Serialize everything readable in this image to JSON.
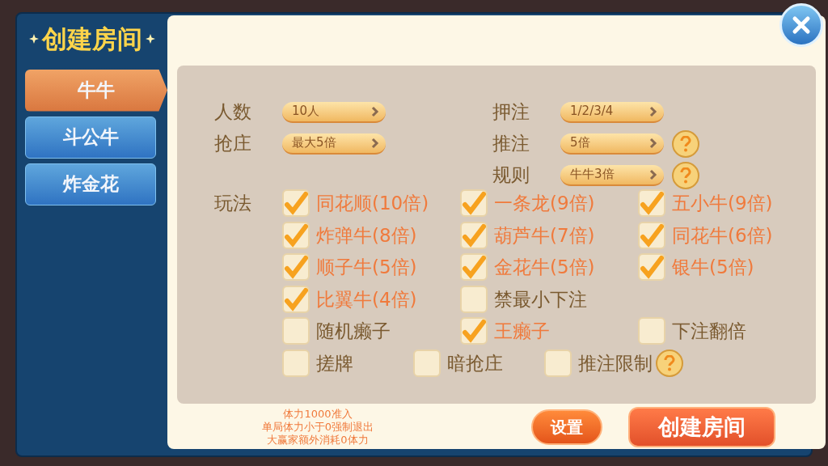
{
  "title": "创建房间",
  "tabs": [
    {
      "label": "牛牛",
      "selected": true
    },
    {
      "label": "斗公牛",
      "selected": false
    },
    {
      "label": "炸金花",
      "selected": false
    }
  ],
  "settings_left": [
    {
      "label": "人数",
      "value": "10人",
      "help": false
    },
    {
      "label": "抢庄",
      "value": "最大5倍",
      "help": false
    }
  ],
  "settings_right": [
    {
      "label": "押注",
      "value": "1/2/3/4",
      "help": false
    },
    {
      "label": "推注",
      "value": "5倍",
      "help": true
    },
    {
      "label": "规则",
      "value": "牛牛3倍",
      "help": true
    }
  ],
  "play_label": "玩法",
  "option_rows": [
    [
      {
        "label": "同花顺(10倍)",
        "checked": true
      },
      {
        "label": "一条龙(9倍)",
        "checked": true
      },
      {
        "label": "五小牛(9倍)",
        "checked": true
      }
    ],
    [
      {
        "label": "炸弹牛(8倍)",
        "checked": true
      },
      {
        "label": "葫芦牛(7倍)",
        "checked": true
      },
      {
        "label": "同花牛(6倍)",
        "checked": true
      }
    ],
    [
      {
        "label": "顺子牛(5倍)",
        "checked": true
      },
      {
        "label": "金花牛(5倍)",
        "checked": true
      },
      {
        "label": "银牛(5倍)",
        "checked": true
      }
    ],
    [
      {
        "label": "比翼牛(4倍)",
        "checked": true
      },
      {
        "label": "禁最小下注",
        "checked": false
      }
    ],
    [
      {
        "label": "随机癞子",
        "checked": false
      },
      {
        "label": "王癞子",
        "checked": true
      },
      {
        "label": "下注翻倍",
        "checked": false
      }
    ]
  ],
  "extra_options": [
    {
      "label": "搓牌",
      "checked": false,
      "help": false
    },
    {
      "label": "暗抢庄",
      "checked": false,
      "help": false
    },
    {
      "label": "推注限制",
      "checked": false,
      "help": true
    }
  ],
  "notes": [
    "体力1000准入",
    "单局体力小于0强制退出",
    "大赢家额外消耗0体力"
  ],
  "settings_button": "设置",
  "create_button": "创建房间"
}
